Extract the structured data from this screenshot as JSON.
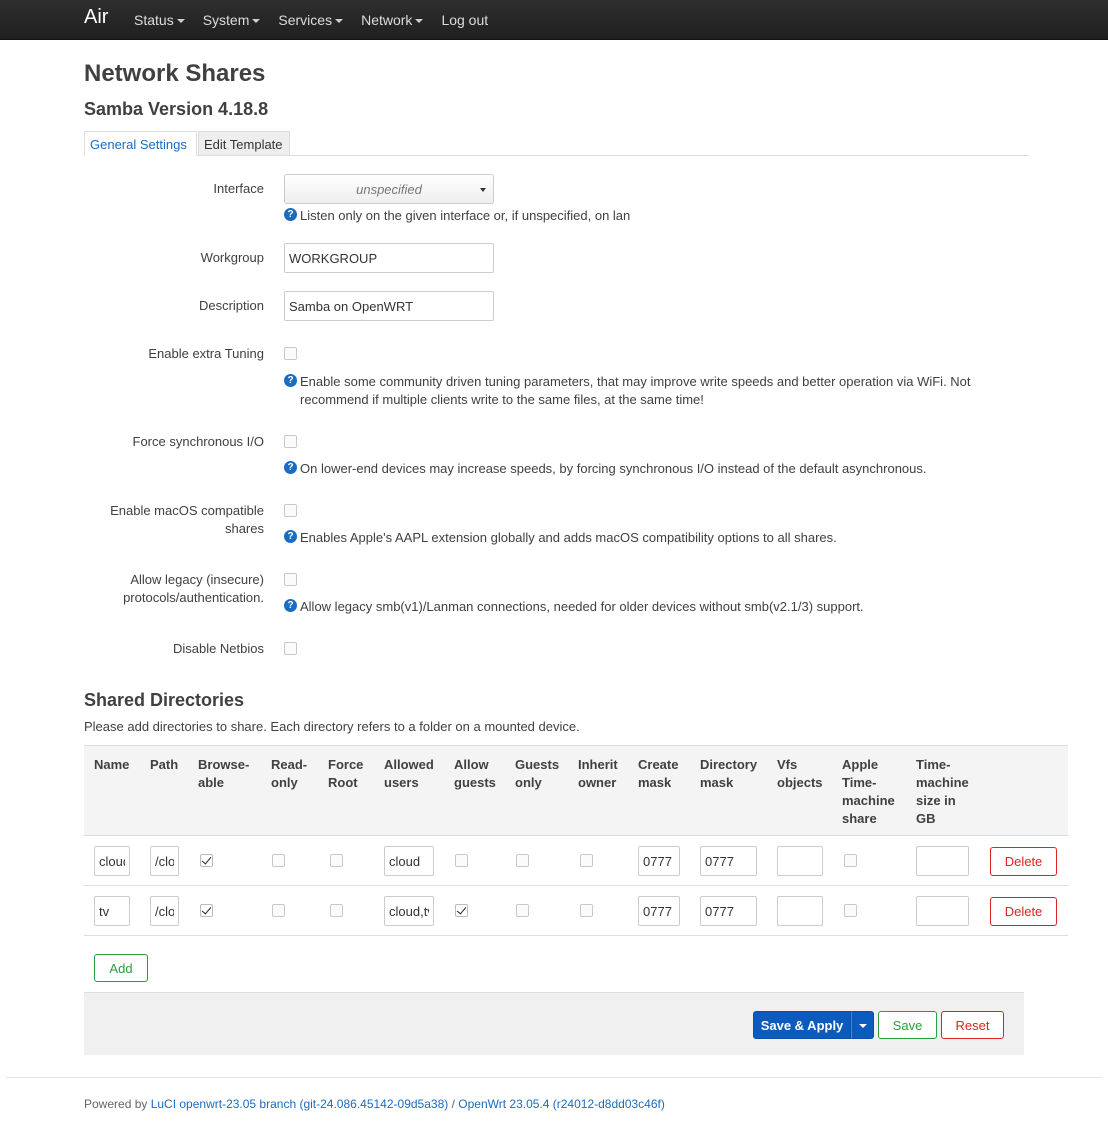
{
  "brand": "Air",
  "nav": [
    "Status",
    "System",
    "Services",
    "Network",
    "Log out"
  ],
  "page": {
    "title": "Network Shares",
    "subtitle": "Samba Version 4.18.8"
  },
  "tabs": [
    "General Settings",
    "Edit Template"
  ],
  "settings": {
    "interface": {
      "label": "Interface",
      "value": "unspecified",
      "hint": "Listen only on the given interface or, if unspecified, on lan"
    },
    "workgroup": {
      "label": "Workgroup",
      "value": "WORKGROUP"
    },
    "description": {
      "label": "Description",
      "value": "Samba on OpenWRT"
    },
    "extra_tuning": {
      "label": "Enable extra Tuning",
      "checked": false,
      "hint_line1": "Enable some community driven tuning parameters, that may improve write speeds and better operation via WiFi. Not",
      "hint_line2": "recommend if multiple clients write to the same files, at the same time!"
    },
    "force_sync": {
      "label": "Force synchronous I/O",
      "checked": false,
      "hint": "On lower-end devices may increase speeds, by forcing synchronous I/O instead of the default asynchronous."
    },
    "macos": {
      "label_line1": "Enable macOS compatible",
      "label_line2": "shares",
      "checked": false,
      "hint": "Enables Apple's AAPL extension globally and adds macOS compatibility options to all shares."
    },
    "legacy": {
      "label_line1": "Allow legacy (insecure)",
      "label_line2": "protocols/authentication.",
      "checked": false,
      "hint": "Allow legacy smb(v1)/Lanman connections, needed for older devices without smb(v2.1/3) support."
    },
    "netbios": {
      "label": "Disable Netbios",
      "checked": false
    }
  },
  "shares": {
    "title": "Shared Directories",
    "description": "Please add directories to share. Each directory refers to a folder on a mounted device.",
    "columns": [
      [
        "Name"
      ],
      [
        "Path"
      ],
      [
        "Browse-",
        "able"
      ],
      [
        "Read-",
        "only"
      ],
      [
        "Force",
        "Root"
      ],
      [
        "Allowed",
        "users"
      ],
      [
        "Allow",
        "guests"
      ],
      [
        "Guests",
        "only"
      ],
      [
        "Inherit",
        "owner"
      ],
      [
        "Create",
        "mask"
      ],
      [
        "Directory",
        "mask"
      ],
      [
        "Vfs",
        "objects"
      ],
      [
        "Apple",
        "Time-",
        "machine",
        "share"
      ],
      [
        "Time-",
        "machine",
        "size in",
        "GB"
      ]
    ],
    "rows": [
      {
        "name": "cloud",
        "path": "/cloud",
        "browseable": true,
        "read_only": false,
        "force_root": false,
        "users": "cloud",
        "allow_guests": false,
        "guests_only": false,
        "inherit_owner": false,
        "create_mask": "0777",
        "dir_mask": "0777",
        "vfs": "",
        "timemachine": false,
        "tm_size": "",
        "delete_label": "Delete"
      },
      {
        "name": "tv",
        "path": "/cloud",
        "browseable": true,
        "read_only": false,
        "force_root": false,
        "users": "cloud,tv",
        "allow_guests": true,
        "guests_only": false,
        "inherit_owner": false,
        "create_mask": "0777",
        "dir_mask": "0777",
        "vfs": "",
        "timemachine": false,
        "tm_size": "",
        "delete_label": "Delete"
      }
    ],
    "add_label": "Add"
  },
  "actions": {
    "save_apply": "Save & Apply",
    "save": "Save",
    "reset": "Reset"
  },
  "footer": {
    "prefix": "Powered by ",
    "luci": "LuCI openwrt-23.05 branch (git-24.086.45142-09d5a38)",
    "sep": " / ",
    "openwrt": "OpenWrt 23.05.4 (r24012-d8dd03c46f)"
  },
  "colors": {
    "accent_blue": "#0b5bbf",
    "link_blue": "#1a6cc2",
    "add_green": "#2a9d3a",
    "delete_red": "#dd2222",
    "topbar": "#262626"
  }
}
